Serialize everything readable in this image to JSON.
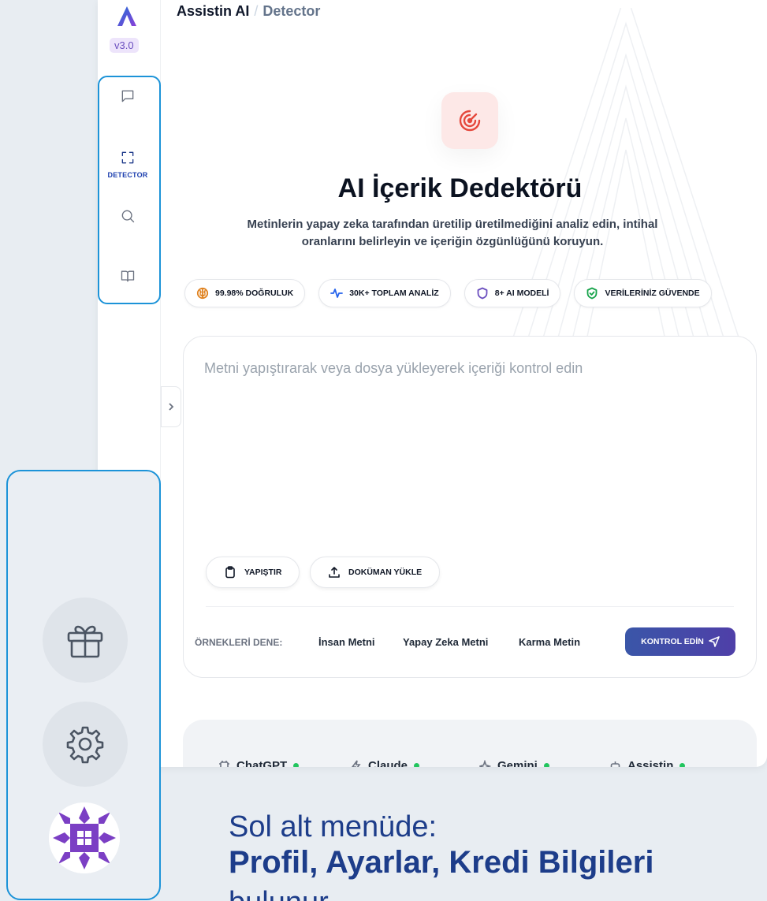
{
  "app": {
    "version": "v3.0",
    "breadcrumb": {
      "root": "Assistin AI",
      "separator": "/",
      "current": "Detector"
    }
  },
  "rail": {
    "items": [
      {
        "icon": "chat-icon",
        "label": ""
      },
      {
        "icon": "scan-icon",
        "label": "DETECTOR",
        "active": true
      },
      {
        "icon": "search-icon",
        "label": ""
      },
      {
        "icon": "book-icon",
        "label": ""
      }
    ]
  },
  "hero": {
    "icon": "radar-icon",
    "title": "AI İçerik Dedektörü",
    "subtitle": "Metinlerin yapay zeka tarafından üretilip üretilmediğini analiz edin, intihal oranlarını belirleyin ve içeriğin özgünlüğünü koruyun."
  },
  "stats": [
    {
      "icon": "brain-icon",
      "label": "99.98% DOĞRULUK",
      "color": "#e0821f"
    },
    {
      "icon": "activity-icon",
      "label": "30K+ TOPLAM ANALİZ",
      "color": "#2563eb"
    },
    {
      "icon": "shield-icon",
      "label": "8+ AI MODELİ",
      "color": "#6b4fbf"
    },
    {
      "icon": "shield-check-icon",
      "label": "VERİLERİNİZ GÜVENDE",
      "color": "#16a34a"
    }
  ],
  "editor": {
    "placeholder": "Metni yapıştırarak veya dosya yükleyerek içeriği kontrol edin",
    "paste_label": "YAPIŞTIR",
    "upload_label": "DOKÜMAN YÜKLE",
    "examples_label": "ÖRNEKLERİ DENE:",
    "examples": [
      "İnsan Metni",
      "Yapay Zeka Metni",
      "Karma Metin"
    ],
    "submit_label": "KONTROL EDİN"
  },
  "models": [
    {
      "icon": "chip-icon",
      "name": "ChatGPT",
      "status": "online"
    },
    {
      "icon": "bolt-icon",
      "name": "Claude",
      "status": "online"
    },
    {
      "icon": "sparkle-icon",
      "name": "Gemini",
      "status": "online"
    },
    {
      "icon": "bot-icon",
      "name": "Assistin",
      "status": "online"
    }
  ],
  "bottom_menu": {
    "items": [
      {
        "icon": "gift-icon"
      },
      {
        "icon": "gear-icon"
      },
      {
        "icon": "avatar"
      }
    ]
  },
  "caption": {
    "line1": "Sol alt menüde:",
    "line2": "Profil, Ayarlar, Kredi Bilgileri",
    "line3": "bulunur."
  },
  "colors": {
    "accent": "#1c93d8",
    "brand": "#3a56a8",
    "status_online": "#22c55e"
  }
}
